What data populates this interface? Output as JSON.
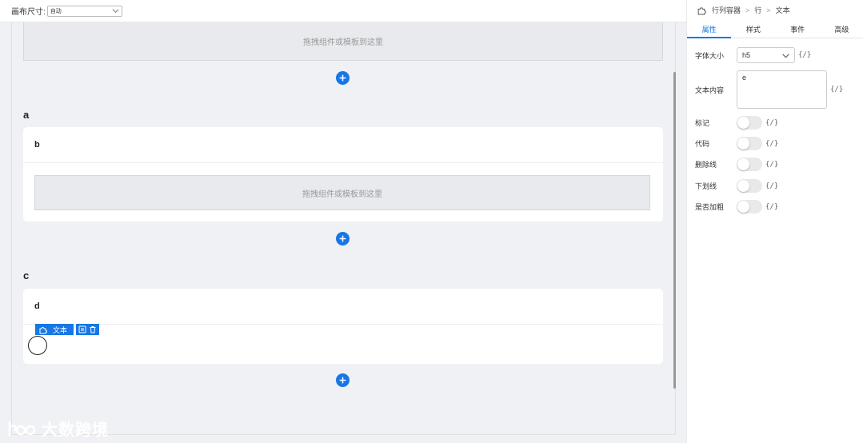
{
  "topbar": {
    "canvas_size_label": "画布尺寸:",
    "canvas_size_value": "自动"
  },
  "canvas": {
    "dropzone_text": "拖拽组件或模板到这里",
    "sections": [
      {
        "title": "a",
        "card_title": "b"
      },
      {
        "title": "c",
        "card_title": "d"
      }
    ],
    "selected_component": {
      "tag_label": "文本"
    }
  },
  "watermark": {
    "text": "大数跨境"
  },
  "panel": {
    "breadcrumb": [
      "行列容器",
      "行",
      "文本"
    ],
    "breadcrumb_sep": ">",
    "tabs": [
      "属性",
      "样式",
      "事件",
      "高级"
    ],
    "active_tab": "属性",
    "expr_label": "{/}",
    "props": {
      "font_size_label": "字体大小",
      "font_size_value": "h5",
      "content_label": "文本内容",
      "content_value": "e",
      "mark_label": "标记",
      "code_label": "代码",
      "strike_label": "删除线",
      "underline_label": "下划线",
      "bold_label": "是否加粗"
    }
  },
  "colors": {
    "accent": "#1677e6",
    "canvas_bg": "#f0f1f5"
  }
}
